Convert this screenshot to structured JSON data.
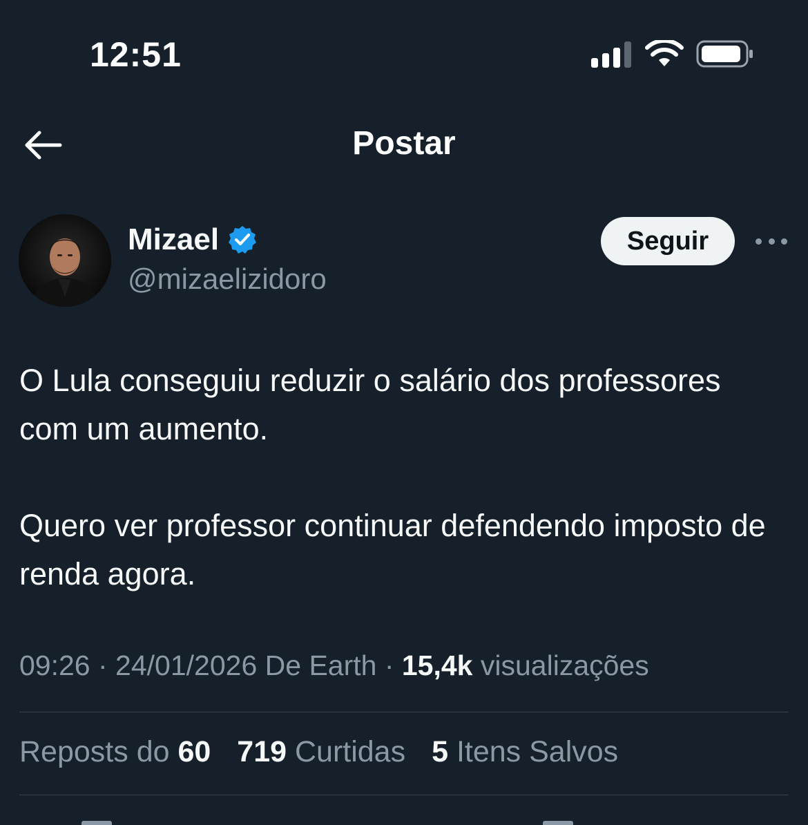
{
  "status_bar": {
    "time": "12:51",
    "icons": [
      "cellular-signal-icon",
      "wifi-icon",
      "battery-icon"
    ]
  },
  "header": {
    "title": "Postar",
    "back_icon": "arrow-left-icon"
  },
  "author": {
    "name": "Mizael",
    "handle": "@mizaelizidoro",
    "verified_icon": "verified-badge-icon",
    "verified_color": "#1d9bf0",
    "follow_label": "Seguir",
    "more_icon": "more-horizontal-icon"
  },
  "post": {
    "paragraph1": "O Lula conseguiu reduzir o salário dos professores com um aumento.",
    "paragraph2": "Quero ver professor continuar defendendo imposto de renda agora."
  },
  "meta": {
    "time": "09:26",
    "separator1": " · ",
    "date_source": "24/01/2026 De Earth",
    "separator2": " · ",
    "views_count": "15,4k",
    "views_label": "visualizações"
  },
  "stats": {
    "reposts_label": "Reposts do",
    "reposts_count": "60",
    "likes_count": "719",
    "likes_label": "Curtidas",
    "saves_count": "5",
    "saves_label": "Itens Salvos"
  },
  "colors": {
    "background": "#15202b",
    "text_primary": "#f7f9f9",
    "text_secondary": "#8b98a5",
    "divider": "#38444d",
    "follow_button_bg": "#eff3f4"
  }
}
